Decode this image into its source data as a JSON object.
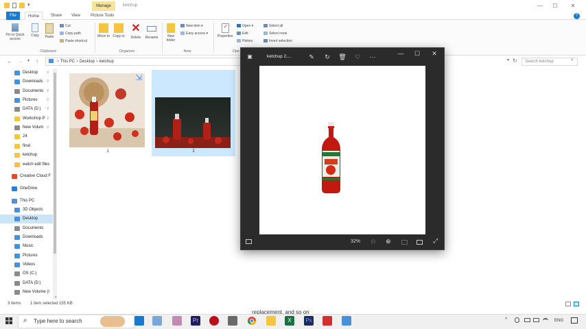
{
  "window": {
    "manage_tab": "Manage",
    "title": "ketchup",
    "minimize": "—",
    "maximize": "☐",
    "close": "✕",
    "help": "?"
  },
  "ribbon_tabs": {
    "file": "File",
    "home": "Home",
    "share": "Share",
    "view": "View",
    "picture_tools": "Picture Tools"
  },
  "ribbon": {
    "pin_quick_access": "Pin to Quick access",
    "copy": "Copy",
    "paste": "Paste",
    "cut": "Cut",
    "copy_path": "Copy path",
    "paste_shortcut": "Paste shortcut",
    "clipboard_label": "Clipboard",
    "move_to": "Move to",
    "copy_to": "Copy to",
    "delete": "Delete",
    "rename": "Rename",
    "organize_label": "Organize",
    "new_folder": "New folder",
    "new_item": "New item",
    "easy_access": "Easy access",
    "new_label": "New",
    "properties": "Properties",
    "open": "Open",
    "edit": "Edit",
    "history": "History",
    "open_label": "Ope",
    "select_all": "Select all",
    "select_none": "Select none",
    "invert_selection": "Invert selection"
  },
  "address": {
    "path": [
      "This PC",
      "Desktop",
      "ketchup"
    ],
    "sep": ">",
    "search_placeholder": "Search ketchup"
  },
  "nav": {
    "quick_access": [
      {
        "label": "Desktop",
        "pinned": true
      },
      {
        "label": "Downloads",
        "pinned": true
      },
      {
        "label": "Documents",
        "pinned": true
      },
      {
        "label": "Pictures",
        "pinned": true
      },
      {
        "label": "DATA (D:)",
        "pinned": true
      },
      {
        "label": "Workshop P",
        "pinned": true
      },
      {
        "label": "New Volum",
        "pinned": true
      },
      {
        "label": "24",
        "pinned": false
      },
      {
        "label": "final",
        "pinned": false
      },
      {
        "label": "ketchup",
        "pinned": false
      },
      {
        "label": "watch edit files",
        "pinned": false
      }
    ],
    "creative_cloud": "Creative Cloud F",
    "onedrive": "OneDrive",
    "this_pc": "This PC",
    "this_pc_items": [
      "3D Objects",
      "Desktop",
      "Documents",
      "Downloads",
      "Music",
      "Pictures",
      "Videos",
      "OS (C:)",
      "DATA (D:)",
      "New Volume (I"
    ]
  },
  "files": [
    {
      "name": "1"
    },
    {
      "name": "2"
    }
  ],
  "status": {
    "items": "3 items",
    "selected": "1 item selected  155 KB"
  },
  "viewer": {
    "title": "ketchup 2....",
    "zoom": "32%",
    "more": "···"
  },
  "taskbar": {
    "search_placeholder": "Type here to search",
    "lang": "ENG"
  },
  "subtitle": "replacement, and so on",
  "colors": {
    "accent": "#1979ca",
    "selection": "#cce8ff",
    "manage_tab": "#f7e39a"
  }
}
